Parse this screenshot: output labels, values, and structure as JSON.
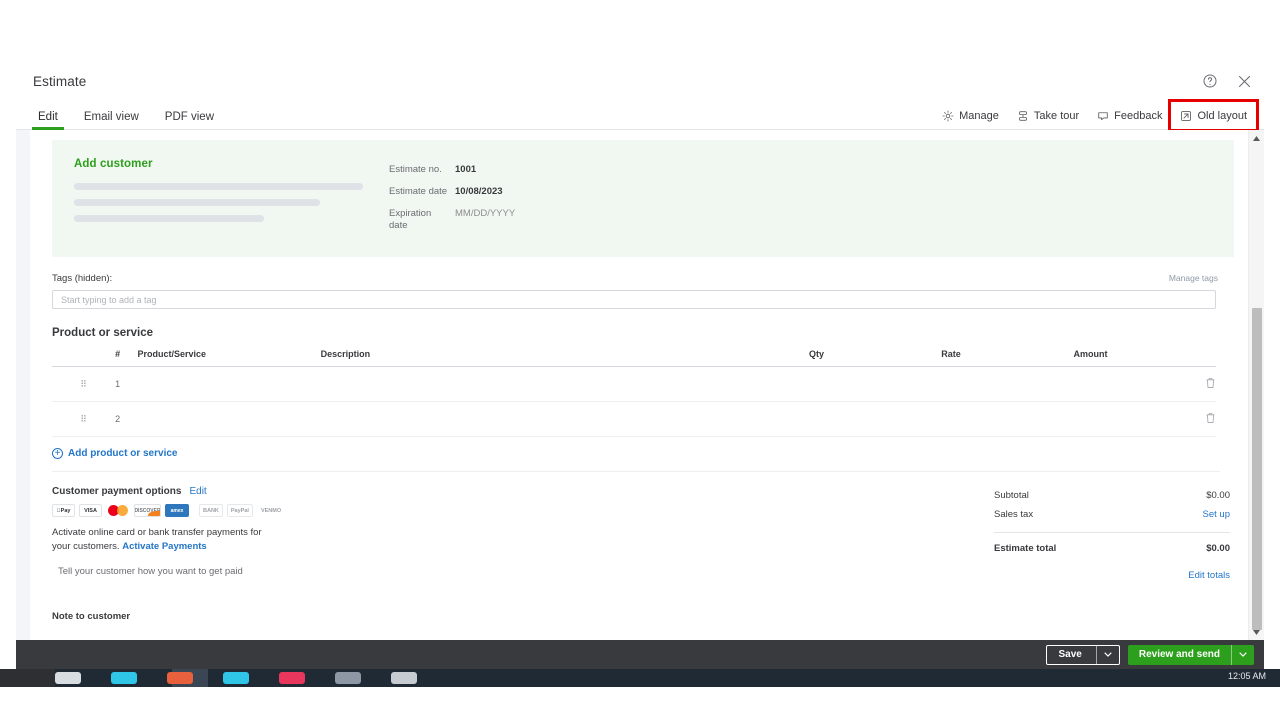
{
  "window": {
    "title": "Estimate",
    "help_icon": "help-circle-icon",
    "close_icon": "close-icon"
  },
  "tabs": [
    {
      "label": "Edit",
      "active": true
    },
    {
      "label": "Email view",
      "active": false
    },
    {
      "label": "PDF view",
      "active": false
    }
  ],
  "toolbar": {
    "manage": "Manage",
    "take_tour": "Take tour",
    "feedback": "Feedback",
    "old_layout": "Old layout",
    "highlight_color": "#e60000"
  },
  "customer": {
    "add_customer_label": "Add customer",
    "accent_color": "#2ca01c",
    "banner_color": "#f1f7f1",
    "meta": [
      {
        "label": "Estimate no.",
        "value": "1001",
        "placeholder": false
      },
      {
        "label": "Estimate date",
        "value": "10/08/2023",
        "placeholder": false
      },
      {
        "label": "Expiration date",
        "value": "MM/DD/YYYY",
        "placeholder": true
      }
    ]
  },
  "tags": {
    "label": "Tags (hidden):",
    "placeholder": "Start typing to add a tag",
    "manage_link": "Manage tags"
  },
  "products": {
    "section_title": "Product or service",
    "columns": [
      "",
      "#",
      "Product/Service",
      "Description",
      "Qty",
      "Rate",
      "Amount",
      ""
    ],
    "rows": [
      {
        "num": "1",
        "product": "",
        "description": "",
        "qty": "",
        "rate": "",
        "amount": ""
      },
      {
        "num": "2",
        "product": "",
        "description": "",
        "qty": "",
        "rate": "",
        "amount": ""
      }
    ],
    "add_link": "Add product or service"
  },
  "payment": {
    "title": "Customer payment options",
    "edit_label": "Edit",
    "badges": [
      "Pay",
      "VISA",
      "mastercard",
      "DISCOVER",
      "amex",
      "BANK",
      "PayPal",
      "VENMO"
    ],
    "description_1": "Activate online card or bank transfer payments for your customers.",
    "activate_link": "Activate Payments",
    "note_placeholder": "Tell your customer how you want to get paid"
  },
  "totals": {
    "subtotal_label": "Subtotal",
    "subtotal_value": "$0.00",
    "sales_tax_label": "Sales tax",
    "sales_tax_link": "Set up",
    "estimate_total_label": "Estimate total",
    "estimate_total_value": "$0.00",
    "edit_totals_link": "Edit totals"
  },
  "note": {
    "title": "Note to customer"
  },
  "footer": {
    "save_label": "Save",
    "primary_label": "Review and send",
    "primary_color": "#2ca01c",
    "bar_color": "#393a3d"
  },
  "taskbar": {
    "clock": "12:05 AM"
  }
}
